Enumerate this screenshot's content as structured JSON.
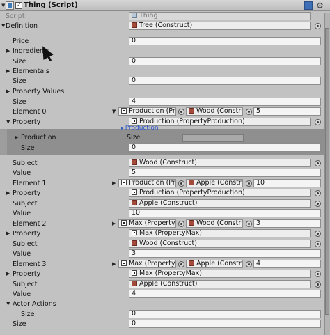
{
  "header": {
    "title": "Thing (Script)",
    "checked": "✓",
    "book_icon": "book-icon",
    "gear_icon": "gear-icon"
  },
  "rows": {
    "script": {
      "label": "Script",
      "value": "Thing"
    },
    "definition": {
      "label": "Definition",
      "value": "Tree (Construct)"
    },
    "price": {
      "label": "Price",
      "value": "0"
    },
    "ingredients": {
      "label": "Ingredients"
    },
    "size1": {
      "label": "Size",
      "value": "0"
    },
    "elementals": {
      "label": "Elementals"
    },
    "size2": {
      "label": "Size",
      "value": "0"
    },
    "property_values": {
      "label": "Property Values"
    },
    "size3": {
      "label": "Size",
      "value": "4"
    },
    "el0": {
      "label": "Element 0",
      "prop": "Production (Pro",
      "subject": "Wood (Construc",
      "value": "5"
    },
    "property0": {
      "label": "Property",
      "value": "Production (PropertyProduction)"
    },
    "dropdown": {
      "label": "Production"
    },
    "production_foldout": {
      "label": "Production"
    },
    "size_inner": {
      "label": "Size",
      "value": "0"
    },
    "size_mini": {
      "label": "Size",
      "value": "0"
    },
    "subject0": {
      "label": "Subject",
      "value": "Wood (Construct)"
    },
    "value0": {
      "label": "Value",
      "value": "5"
    },
    "el1": {
      "label": "Element 1",
      "prop": "Production (Pro",
      "subject": "Apple (Construc",
      "value": "10"
    },
    "property1": {
      "label": "Property",
      "value": "Production (PropertyProduction)"
    },
    "subject1": {
      "label": "Subject",
      "value": "Apple (Construct)"
    },
    "value1": {
      "label": "Value",
      "value": "10"
    },
    "el2": {
      "label": "Element 2",
      "prop": "Max (PropertyM",
      "subject": "Wood (Construc",
      "value": "3"
    },
    "property2": {
      "label": "Property",
      "value": "Max (PropertyMax)"
    },
    "subject2": {
      "label": "Subject",
      "value": "Wood (Construct)"
    },
    "value2": {
      "label": "Value",
      "value": "3"
    },
    "el3": {
      "label": "Element 3",
      "prop": "Max (PropertyM",
      "subject": "Apple (Construc",
      "value": "4"
    },
    "property3": {
      "label": "Property",
      "value": "Max (PropertyMax)"
    },
    "subject3": {
      "label": "Subject",
      "value": "Apple (Construct)"
    },
    "value3": {
      "label": "Value",
      "value": "4"
    },
    "actor_actions": {
      "label": "Actor Actions"
    },
    "size4": {
      "label": "Size",
      "value": "0"
    },
    "size5": {
      "label": "Size",
      "value": "0"
    }
  }
}
